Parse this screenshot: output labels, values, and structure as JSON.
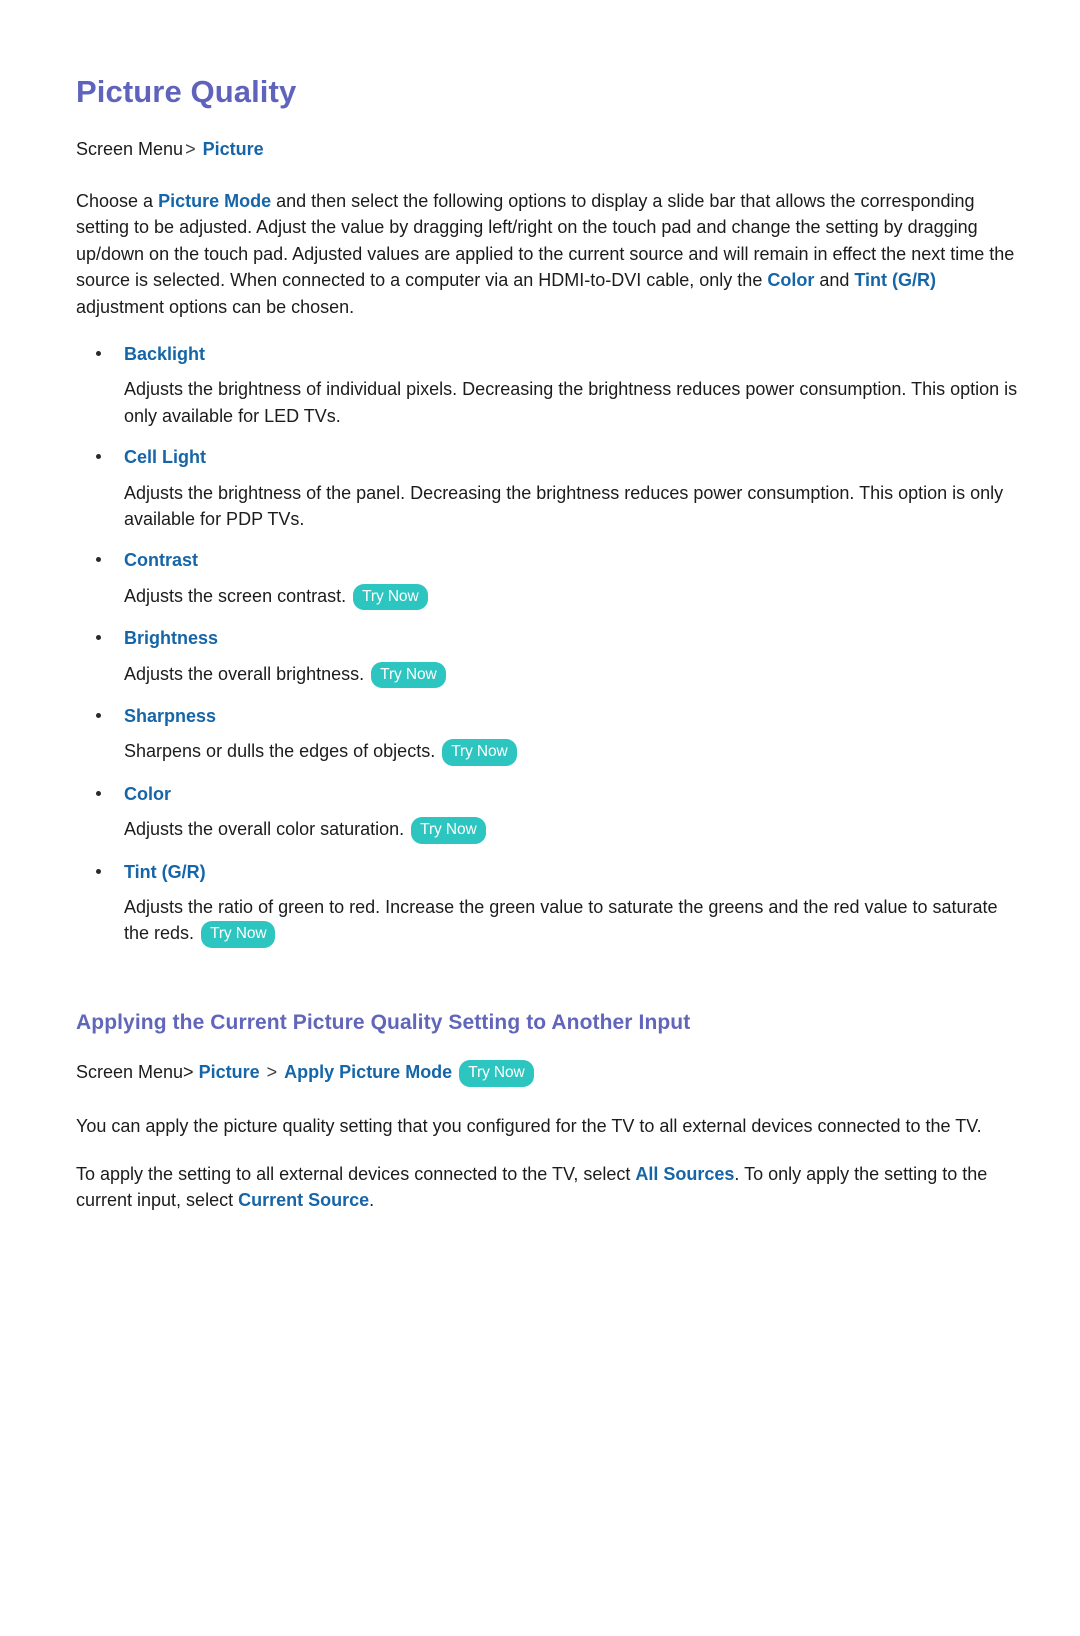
{
  "document": {
    "title": "Picture Quality",
    "try_now_label": "Try Now",
    "bullet_glyph": "•",
    "breadcrumb_separator": ">",
    "colors": {
      "title_purple": "#5f63bc",
      "link_blue": "#1565a8",
      "body_text": "#1c1c1c",
      "try_now_teal": "#2cc5c0",
      "try_now_text": "#ffffff",
      "page_background": "#ffffff"
    }
  },
  "breadcrumb_top": {
    "root": "Screen Menu",
    "separator": ">",
    "leaf": "Picture"
  },
  "intro": {
    "part1": "Choose a ",
    "link1": "Picture Mode",
    "part2": " and then select the following options to display a slide bar that allows the corresponding setting to be adjusted. Adjust the value by dragging left/right on the touch pad and change the setting by dragging up/down on the touch pad. Adjusted values are applied to the current source and will remain in effect the next time the source is selected. When connected to a computer via an HDMI-to-DVI cable, only the ",
    "link2": "Color",
    "part3": " and ",
    "link3": "Tint (G/R)",
    "part4": " adjustment options can be chosen."
  },
  "options": [
    {
      "name": "Backlight",
      "description": "Adjusts the brightness of individual pixels. Decreasing the brightness reduces power consumption. This option is only available for LED TVs.",
      "has_try_now": false
    },
    {
      "name": "Cell Light",
      "description": "Adjusts the brightness of the panel. Decreasing the brightness reduces power consumption. This option is only available for PDP TVs.",
      "has_try_now": false
    },
    {
      "name": "Contrast",
      "description": "Adjusts the screen contrast.",
      "has_try_now": true
    },
    {
      "name": "Brightness",
      "description": "Adjusts the overall brightness.",
      "has_try_now": true
    },
    {
      "name": "Sharpness",
      "description": "Sharpens or dulls the edges of objects.",
      "has_try_now": true
    },
    {
      "name": "Color",
      "description": "Adjusts the overall color saturation.",
      "has_try_now": true
    },
    {
      "name": "Tint (G/R)",
      "description": "Adjusts the ratio of green to red. Increase the green value to saturate the greens and the red value to saturate the reds.",
      "has_try_now": true
    }
  ],
  "section": {
    "heading": "Applying the Current Picture Quality Setting to Another Input",
    "breadcrumb": {
      "root": "Screen Menu>",
      "crumb1": "Picture",
      "separator": ">",
      "crumb2": "Apply Picture Mode"
    },
    "paragraph1": "You can apply the picture quality setting that you configured for the TV to all external devices connected to the TV.",
    "paragraph2": {
      "part1": "To apply the setting to all external devices connected to the TV, select ",
      "link1": "All Sources",
      "part2": ". To only apply the setting to the current input, select ",
      "link2": "Current Source",
      "part3": "."
    }
  }
}
